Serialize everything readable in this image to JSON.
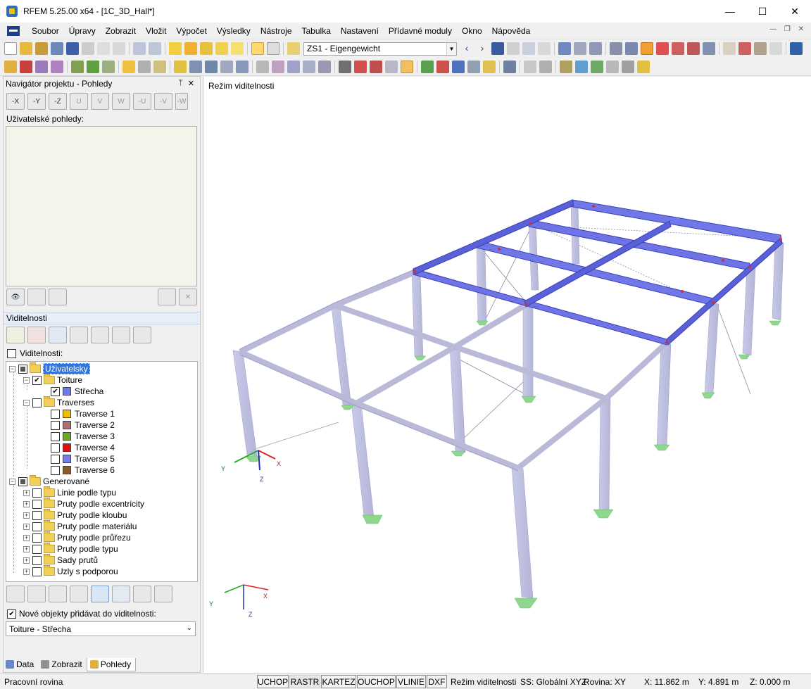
{
  "window": {
    "title": "RFEM 5.25.00 x64 - [1C_3D_Hall*]",
    "minimize": "—",
    "maximize": "☐",
    "close": "✕"
  },
  "menu": [
    "Soubor",
    "Úpravy",
    "Zobrazit",
    "Vložit",
    "Výpočet",
    "Výsledky",
    "Nástroje",
    "Tabulka",
    "Nastavení",
    "Přídavné moduly",
    "Okno",
    "Nápověda"
  ],
  "toolbar": {
    "load_case": "ZS1 - Eigengewicht"
  },
  "navigator": {
    "title": "Navigátor projektu - Pohledy",
    "pin": "ᛘ",
    "close": "✕",
    "view_buttons": [
      "-X",
      "-Y",
      "-Z",
      "U",
      "V",
      "W",
      "-U",
      "-V",
      "-W"
    ],
    "user_views_label": "Uživatelské pohledy:",
    "visibility_header": "Viditelnosti",
    "visibility_label": "Viditelnosti:",
    "tree": {
      "root": "Uživatelsky",
      "toiture": "Toiture",
      "strecha": "Střecha",
      "traverses": "Traverses",
      "traverse_items": [
        {
          "label": "Traverse 1",
          "color": "#f0c000"
        },
        {
          "label": "Traverse 2",
          "color": "#b07070"
        },
        {
          "label": "Traverse 3",
          "color": "#6aa82a"
        },
        {
          "label": "Traverse 4",
          "color": "#e01010"
        },
        {
          "label": "Traverse 5",
          "color": "#7b7bf0"
        },
        {
          "label": "Traverse 6",
          "color": "#8a5a2a"
        }
      ],
      "strecha_color": "#6b79f0",
      "generated": "Generované",
      "generated_items": [
        "Linie podle typu",
        "Pruty podle excentricity",
        "Pruty podle kloubu",
        "Pruty podle materiálu",
        "Pruty podle průřezu",
        "Pruty podle typu",
        "Sady prutů",
        "Uzly s podporou"
      ]
    },
    "new_objects_label": "Nové objekty přidávat do viditelnosti:",
    "new_objects_value": "Toiture - Střecha"
  },
  "panel_tabs": [
    "Data",
    "Zobrazit",
    "Pohledy"
  ],
  "viewport": {
    "mode_label": "Režim viditelnosti",
    "axes": {
      "x": "X",
      "y": "Y",
      "z": "Z"
    }
  },
  "status": {
    "left": "Pracovní rovina",
    "buttons": [
      "UCHOP",
      "RASTR",
      "KARTEZ",
      "OUCHOP",
      "VLINIE",
      "DXF"
    ],
    "mode": "Režim viditelnosti",
    "ss": "SS: Globální XYZ",
    "plane": "Rovina: XY",
    "x": "X:  11.862 m",
    "y": "Y:  4.891 m",
    "z": "Z:  0.000 m"
  }
}
